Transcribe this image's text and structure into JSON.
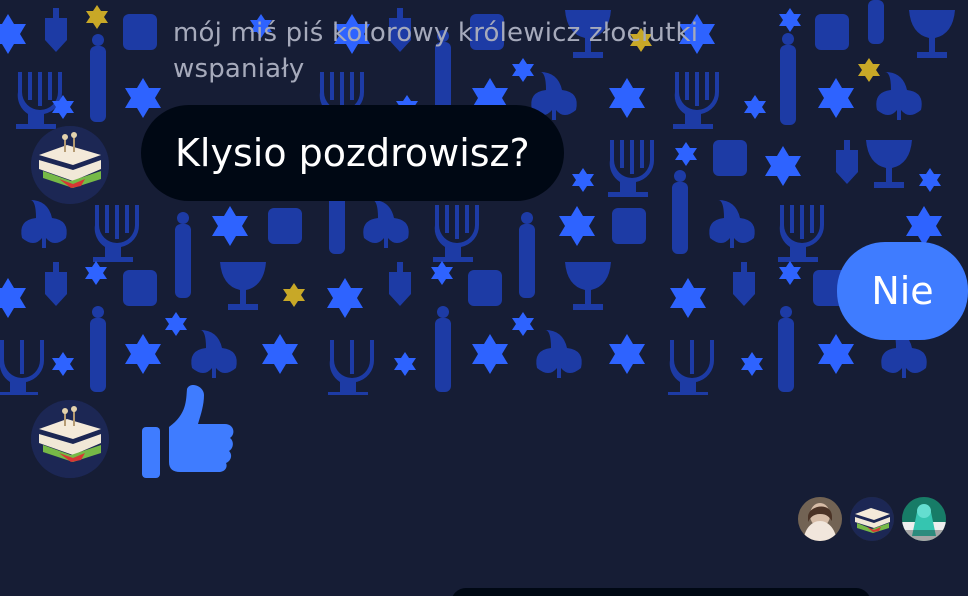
{
  "conversation": {
    "sender_name": "mój miś piś kolorowy królewicz złociutki wspaniały",
    "messages": [
      {
        "direction": "incoming",
        "text": "Klysio pozdrowisz?"
      },
      {
        "direction": "outgoing",
        "text": "Nie"
      }
    ],
    "reaction": {
      "icon": "thumbs-up-icon"
    },
    "read_receipts": [
      {
        "icon": "avatar-photo-person"
      },
      {
        "icon": "avatar-sandwich"
      },
      {
        "icon": "avatar-green-object"
      }
    ]
  },
  "theme": {
    "background": "#161d35",
    "pattern_blue": "#1f3fb3",
    "pattern_star": "#2e63ff",
    "pattern_gold": "#c8a827",
    "incoming_bubble": "#000814",
    "outgoing_bubble": "#3f7cff",
    "like_color": "#3f7cff"
  }
}
